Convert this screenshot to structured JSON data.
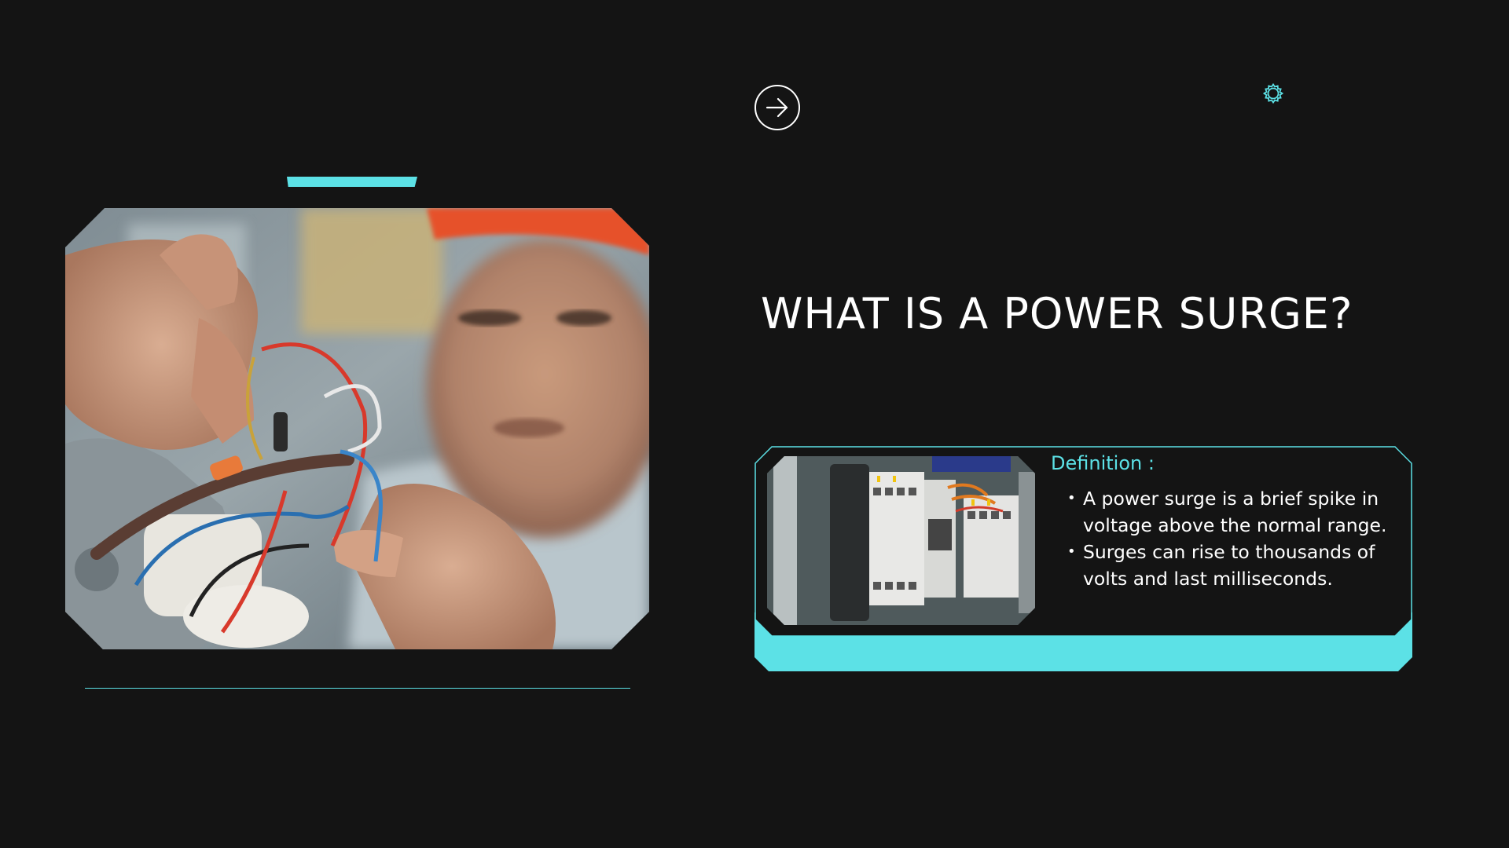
{
  "slide": {
    "title": "WHAT IS A POWER SURGE?",
    "definition_label": "Definition :",
    "bullets": [
      "A power surge is a brief spike in voltage above the normal range.",
      "Surges can rise to thousands of volts and last milliseconds."
    ]
  },
  "icons": {
    "nav": "arrow-right-circle-icon",
    "decor": "gear-icon"
  },
  "colors": {
    "background": "#141414",
    "accent": "#5ce1e6",
    "text": "#ffffff"
  }
}
